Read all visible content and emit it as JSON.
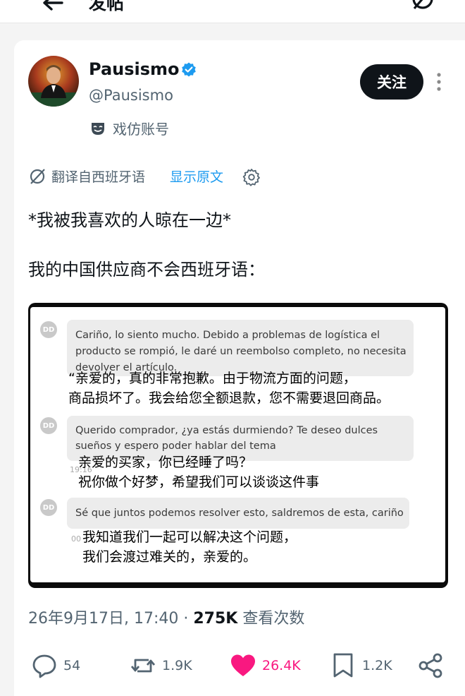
{
  "header": {
    "title": "发帖"
  },
  "post": {
    "author_name": "Pausismo",
    "handle": "@Pausismo",
    "parody_label": "戏仿账号",
    "follow_label": "关注",
    "translate_label": "翻译自西班牙语",
    "show_original_label": "显示原文",
    "text_line1": "*我被我喜欢的人晾在一边*",
    "text_line2": "我的中国供应商不会西班牙语：",
    "date_time": "26年9月17日, 17:40",
    "separator": "·",
    "views_count": "275K",
    "views_label": "查看次数"
  },
  "media": {
    "avatar_initials": "DD",
    "messages": [
      {
        "es_lines": [
          "Cariño, lo siento mucho. Debido a problemas de logística el",
          "producto se rompió, le daré un reembolso completo, no necesita",
          "devolver el artículo."
        ],
        "zh_lines": [
          "“亲爱的，真的非常抱歉。由于物流方面的问题，",
          "商品损坏了。我会给您全额退款，您不需要退回商品。"
        ]
      },
      {
        "es_lines": [
          "Querido comprador, ¿ya estás durmiendo?  Te deseo dulces",
          "sueños y espero poder hablar del tema"
        ],
        "timestamp": "19:16",
        "zh_lines": [
          "亲爱的买家，你已经睡了吗？",
          "祝你做个好梦，希望我们可以谈谈这件事"
        ]
      },
      {
        "es_lines": [
          "Sé que juntos podemos resolver esto, saldremos de esta, cariño"
        ],
        "timestamp": "00",
        "zh_lines": [
          "我知道我们一起可以解决这个问题，",
          "我们会渡过难关的，亲爱的。"
        ]
      }
    ]
  },
  "actions": {
    "replies": "54",
    "reposts": "1.9K",
    "likes": "26.4K",
    "bookmarks": "1.2K"
  },
  "colors": {
    "accent_blue": "#1d9bf0",
    "like_pink": "#f91880",
    "text_secondary": "#536471"
  }
}
